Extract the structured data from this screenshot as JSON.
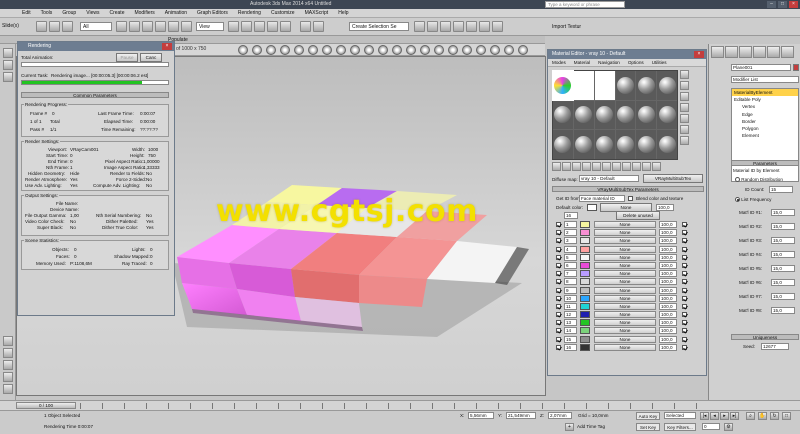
{
  "app": {
    "title": "Autodesk 3ds Max 2014 x64    Untitled",
    "search_placeholder": "Type a keyword or phrase",
    "workspace": "Workspace: Default"
  },
  "menu": [
    "Edit",
    "Tools",
    "Group",
    "Views",
    "Create",
    "Modifiers",
    "Animation",
    "Graph Editors",
    "Rendering",
    "Customize",
    "MAXScript",
    "Help"
  ],
  "toolbar": {
    "sidebar_label": "Slide(x)",
    "filter": "All",
    "view": "View",
    "selection_set": "Create Selection Se",
    "import": "Import Textur"
  },
  "ribbon": {
    "populate": "Populate"
  },
  "viewport": {
    "frame_label": "of 1000 x 750"
  },
  "rendering_dialog": {
    "title": "Rendering",
    "total_animation_label": "Total Animation:",
    "pause_label": "Pause",
    "cancel_label": "Canc",
    "current_task_label": "Current Task:",
    "current_task_value": "Rendering image... [00:00:05.3] [00:00:06.2 est]",
    "common_parameters": "Common Parameters",
    "progress": {
      "header": "Rendering Progress:",
      "frame_label": "Frame #",
      "frame_value": "0",
      "of_label": "1 of 1",
      "total_label": "Total",
      "pass_label": "Pass #",
      "pass_value": "1/1",
      "last_frame_time_label": "Last Frame Time:",
      "last_frame_time_value": "0:00:07",
      "elapsed_label": "Elapsed Time:",
      "elapsed_value": "0:00:00",
      "remaining_label": "Time Remaining:",
      "remaining_value": "??:??:??"
    },
    "render_settings": {
      "header": "Render Settings:",
      "viewport_label": "Viewport:",
      "viewport_value": "VRayCam001",
      "start_label": "Start Time:",
      "start_value": "0",
      "end_label": "End Time:",
      "end_value": "0",
      "nth_label": "Nth Frame:",
      "nth_value": "1",
      "hidden_label": "Hidden Geometry:",
      "hidden_value": "Hide",
      "atmos_label": "Render Atmosphere:",
      "atmos_value": "Yes",
      "advlight_label": "Use Adv. Lighting:",
      "advlight_value": "Yes",
      "width_label": "Width:",
      "width_value": "1000",
      "height_label": "Height:",
      "height_value": "750",
      "pixel_aspect_label": "Pixel Aspect Ratio:",
      "pixel_aspect_value": "1,00000",
      "image_aspect_label": "Image Aspect Ratio:",
      "image_aspect_value": "1,33333",
      "fields_label": "Render to Fields:",
      "fields_value": "No",
      "force2s_label": "Force 2-Sided:",
      "force2s_value": "No",
      "compute_label": "Compute Adv. Lighting:",
      "compute_value": "No"
    },
    "output_settings": {
      "header": "Output Settings:",
      "file_name_label": "File Name:",
      "device_label": "Device Name:",
      "gamma_label": "File Output Gamma:",
      "gamma_value": "1,00",
      "video_color_label": "Video Color Check:",
      "video_color_value": "No",
      "super_black_label": "Super Black:",
      "super_black_value": "No",
      "nth_serial_label": "Nth Serial Numbering:",
      "nth_serial_value": "No",
      "dither_paletted_label": "Dither Paletted:",
      "dither_paletted_value": "Yes",
      "dither_true_label": "Dither True Color:",
      "dither_true_value": "Yes"
    },
    "scene_statistics": {
      "header": "Scene Statistics:",
      "objects_label": "Objects:",
      "objects_value": "0",
      "faces_label": "Faces:",
      "faces_value": "0",
      "memory_label": "Memory Used:",
      "memory_value": "P:1108,6M",
      "lights_label": "Lights:",
      "lights_value": "0",
      "shadow_label": "Shadow Mapped:",
      "shadow_value": "0",
      "ray_label": "Ray Traced:",
      "ray_value": "0"
    }
  },
  "material_editor": {
    "title": "Material Editor - vray 10 - Default",
    "menu": [
      "Modes",
      "Material",
      "Navigation",
      "Options",
      "Utilities"
    ],
    "diffuse_map_label": "Diffuse map:",
    "material_name": "vray 10 - Default",
    "material_type": "VRayMultiSubTex",
    "rollout_title": "VRayMultiSubTex Parameters",
    "get_id_label": "Get ID from:",
    "get_id_value": "Face material ID",
    "blend_label": "Blend color and texture",
    "default_color_label": "Default color:",
    "default_color_map": "None",
    "default_color_value": "100,0",
    "count_value": "16",
    "delete_unused_label": "Delete unused",
    "rows": [
      {
        "id": "1",
        "color": "#f7f7a0",
        "map": "None",
        "value": "100,0"
      },
      {
        "id": "2",
        "color": "#f78fd3",
        "map": "None",
        "value": "100,0"
      },
      {
        "id": "3",
        "color": "#e8e8e8",
        "map": "None",
        "value": "100,0"
      },
      {
        "id": "4",
        "color": "#ffa0a0",
        "map": "None",
        "value": "100,0"
      },
      {
        "id": "5",
        "color": "#f7f7f7",
        "map": "None",
        "value": "100,0"
      },
      {
        "id": "6",
        "color": "#e84bd6",
        "map": "None",
        "value": "100,0"
      },
      {
        "id": "7",
        "color": "#b99cff",
        "map": "None",
        "value": "100,0"
      },
      {
        "id": "8",
        "color": "#d9d9d9",
        "map": "None",
        "value": "100,0"
      },
      {
        "id": "9",
        "color": "#bdbdbd",
        "map": "None",
        "value": "100,0"
      },
      {
        "id": "10",
        "color": "#2aa6ff",
        "map": "None",
        "value": "100,0"
      },
      {
        "id": "11",
        "color": "#20d4d4",
        "map": "None",
        "value": "100,0"
      },
      {
        "id": "12",
        "color": "#1f1fb0",
        "map": "None",
        "value": "100,0"
      },
      {
        "id": "13",
        "color": "#24c424",
        "map": "None",
        "value": "100,0"
      },
      {
        "id": "14",
        "color": "#7cd37c",
        "map": "None",
        "value": "100,0"
      },
      {
        "id": "15",
        "color": "#909090",
        "map": "None",
        "value": "100,0"
      },
      {
        "id": "16",
        "color": "#333333",
        "map": "None",
        "value": "100,0"
      }
    ]
  },
  "command_panel": {
    "object_name": "Plane001",
    "modifier_list": "Modifier List",
    "stack": [
      {
        "label": "MaterialByElement",
        "selected": true,
        "sub": false
      },
      {
        "label": "Editable Poly",
        "selected": false,
        "sub": false
      },
      {
        "label": "Vertex",
        "selected": false,
        "sub": true
      },
      {
        "label": "Edge",
        "selected": false,
        "sub": true
      },
      {
        "label": "Border",
        "selected": false,
        "sub": true
      },
      {
        "label": "Polygon",
        "selected": false,
        "sub": true
      },
      {
        "label": "Element",
        "selected": false,
        "sub": true
      }
    ],
    "parameters_title": "Parameters",
    "material_id_by_element": "Material ID by Element",
    "random_distribution": "Random Distribution",
    "id_count_label": "ID Count:",
    "id_count_value": "15",
    "list_frequency": "List Frequency",
    "mat_ids": [
      {
        "label": "Mat'l ID #1:",
        "value": "15,0"
      },
      {
        "label": "Mat'l ID #2:",
        "value": "15,0"
      },
      {
        "label": "Mat'l ID #3:",
        "value": "15,0"
      },
      {
        "label": "Mat'l ID #4:",
        "value": "15,0"
      },
      {
        "label": "Mat'l ID #5:",
        "value": "15,0"
      },
      {
        "label": "Mat'l ID #6:",
        "value": "15,0"
      },
      {
        "label": "Mat'l ID #7:",
        "value": "15,0"
      },
      {
        "label": "Mat'l ID #8:",
        "value": "15,0"
      }
    ],
    "uniqueness_title": "Uniqueness",
    "seed_label": "Seed:",
    "seed_value": "12677"
  },
  "timeline": {
    "slider": "0 / 100"
  },
  "status": {
    "selected": "1 Object Selected",
    "hint": "Rendering Time 0:00:07",
    "x_value": "5,56mm",
    "y_value": "21,549mm",
    "z_value": "2,07mm",
    "grid": "Grid = 10,0mm",
    "auto_key": "Auto Key",
    "set_key": "Set Key",
    "key_mode": "Selected",
    "key_filters": "Key Filters...",
    "add_time_tag": "Add Time Tag",
    "frame_value": "0"
  },
  "watermark": "www.cgtsj.com",
  "colors": {
    "progress_fill": "#22c422",
    "title_bar": "#3d4653",
    "window_title": "#6d7d91",
    "selected_stack": "#ffd24a",
    "watermark": "#f3e000"
  }
}
